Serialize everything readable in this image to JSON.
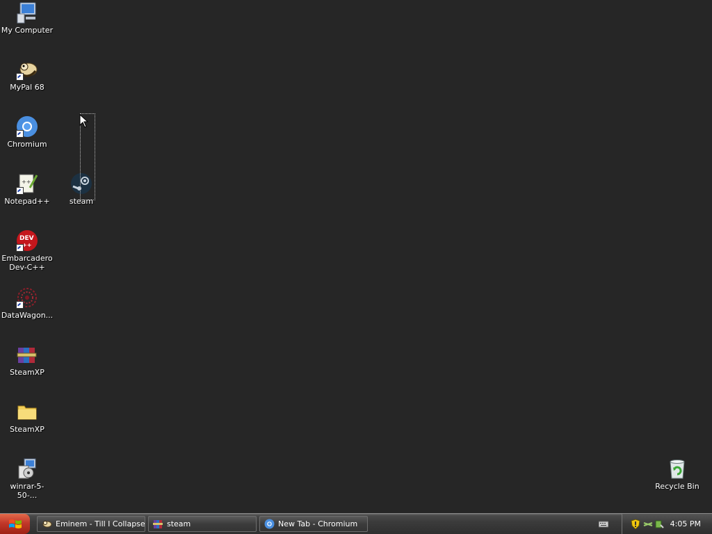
{
  "desktop": {
    "icons": [
      {
        "label": "My Computer"
      },
      {
        "label": "MyPal 68"
      },
      {
        "label": "Chromium"
      },
      {
        "label": "Notepad++"
      },
      {
        "label": "Embarcadero Dev-C++"
      },
      {
        "label": "DataWagon..."
      },
      {
        "label": "SteamXP"
      },
      {
        "label": "SteamXP"
      },
      {
        "label": "winrar-5-50-..."
      },
      {
        "label": "steam"
      },
      {
        "label": "Recycle Bin"
      }
    ]
  },
  "taskbar": {
    "tasks": [
      {
        "label": "Eminem - Till I Collapse..."
      },
      {
        "label": "steam"
      },
      {
        "label": "New Tab - Chromium"
      }
    ],
    "clock": "4:05 PM"
  },
  "colors": {
    "desktop_bg": "#262626",
    "start_button": "#c2382a"
  }
}
